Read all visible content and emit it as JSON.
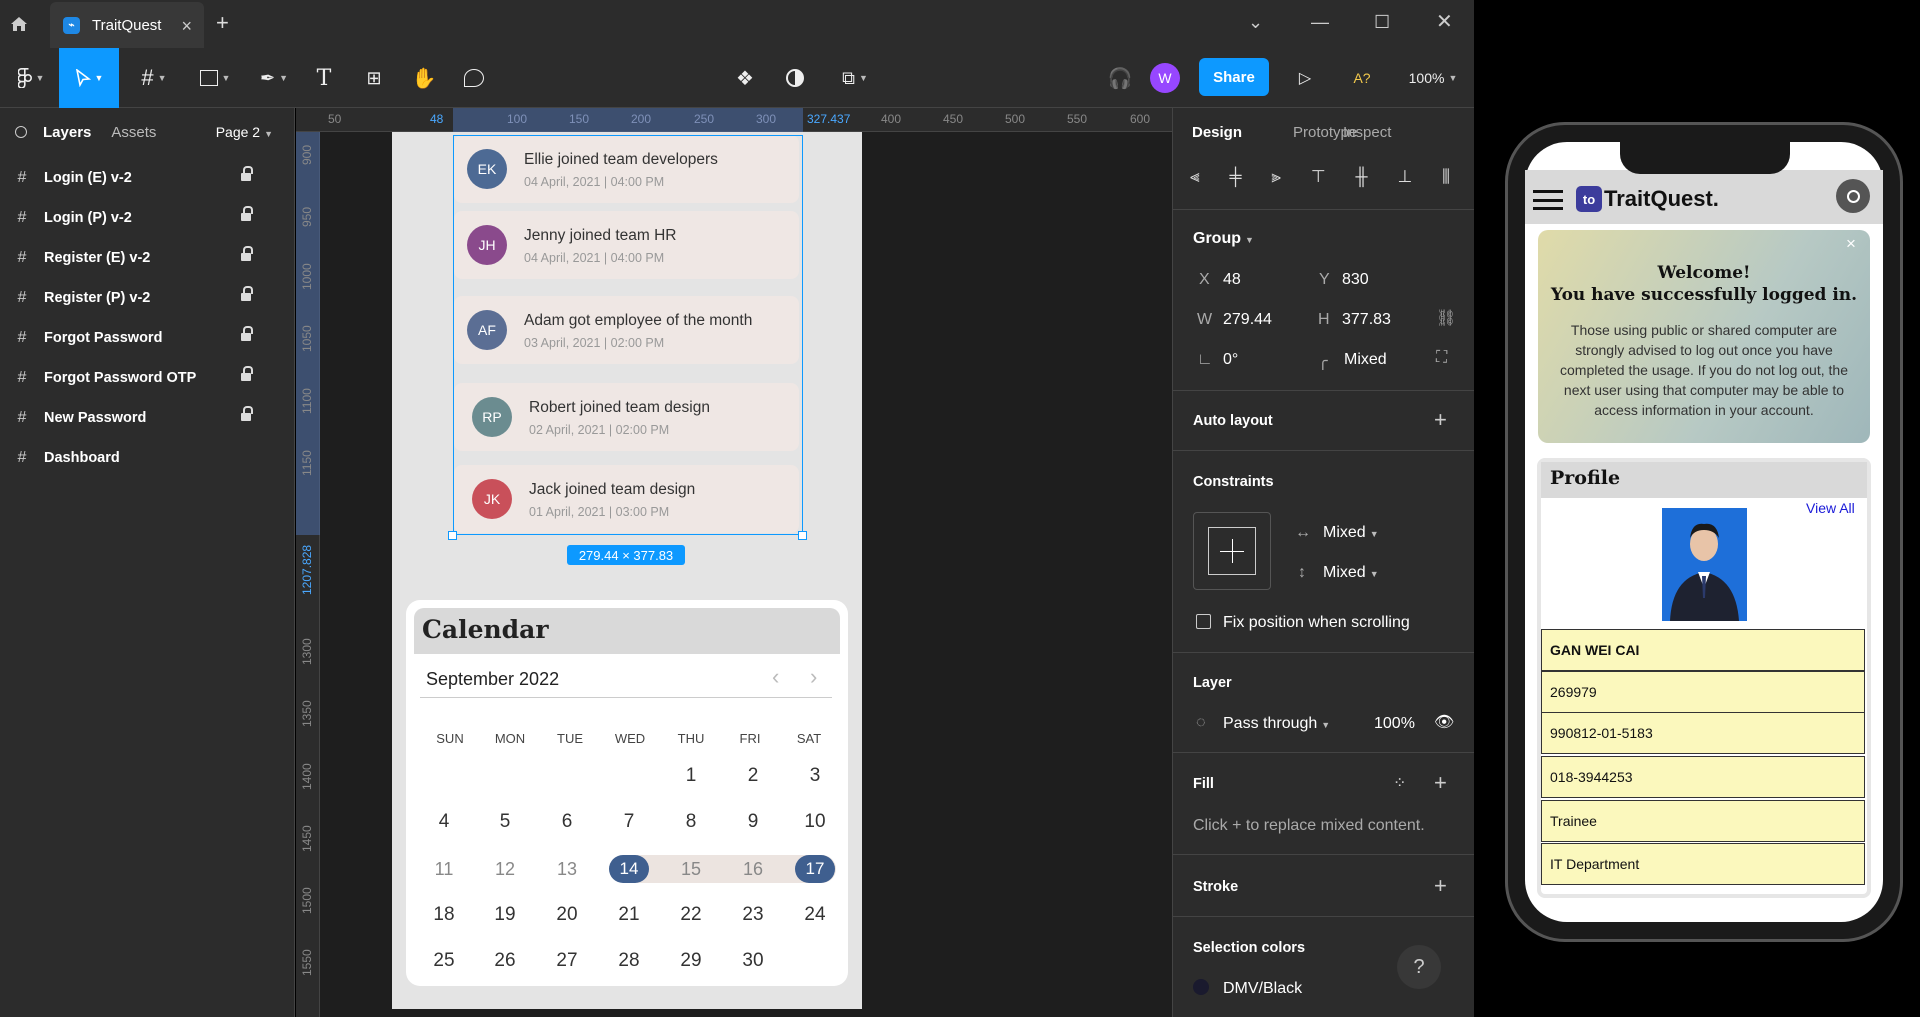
{
  "app": {
    "tab_title": "TraitQuest",
    "colors": {
      "accent": "#0d99ff",
      "panel": "#2c2c2c",
      "canvas": "#1e1e1e",
      "avatar": "#9747ff"
    }
  },
  "toolbar": {
    "share_label": "Share",
    "avatar_initial": "W",
    "font_warning": "A?",
    "zoom": "100%"
  },
  "left_panel": {
    "tabs": {
      "layers": "Layers",
      "assets": "Assets",
      "page": "Page 2"
    },
    "layers": [
      {
        "name": "Login (E) v-2",
        "locked": true
      },
      {
        "name": "Login (P) v-2",
        "locked": true
      },
      {
        "name": "Register (E) v-2",
        "locked": true
      },
      {
        "name": "Register (P) v-2",
        "locked": true
      },
      {
        "name": "Forgot Password",
        "locked": true
      },
      {
        "name": "Forgot Password OTP",
        "locked": true
      },
      {
        "name": "New Password",
        "locked": true
      },
      {
        "name": "Dashboard",
        "locked": false
      }
    ]
  },
  "rulers": {
    "h_ticks": [
      "50",
      "100",
      "150",
      "200",
      "250",
      "300",
      "400",
      "450",
      "500",
      "550",
      "600"
    ],
    "h_sel_start": "48",
    "h_sel_end": "327.437",
    "v_ticks": [
      "900",
      "950",
      "1000",
      "1050",
      "1100",
      "1150",
      "1300",
      "1350",
      "1400",
      "1450",
      "1500",
      "1550"
    ],
    "v_sel_end": "1207.828"
  },
  "canvas": {
    "notifications": [
      {
        "initials": "EK",
        "title": "Ellie joined team developers",
        "date": "04 April, 2021 | 04:00 PM",
        "color": "#4d6a94"
      },
      {
        "initials": "JH",
        "title": "Jenny joined team HR",
        "date": "04 April, 2021 | 04:00 PM",
        "color": "#8a4a8c"
      },
      {
        "initials": "AF",
        "title": "Adam got employee of the month",
        "date": "03 April, 2021 | 02:00 PM",
        "color": "#5b6e94"
      },
      {
        "initials": "RP",
        "title": "Robert joined team design",
        "date": "02 April, 2021 | 02:00 PM",
        "color": "#6b8c90"
      },
      {
        "initials": "JK",
        "title": "Jack joined team design",
        "date": "01 April, 2021 | 03:00 PM",
        "color": "#c9505a"
      }
    ],
    "size_badge": "279.44 × 377.83",
    "calendar": {
      "title": "Calendar",
      "month": "September 2022",
      "prev": "‹",
      "next": "›",
      "weekdays": [
        "SUN",
        "MON",
        "TUE",
        "WED",
        "THU",
        "FRI",
        "SAT"
      ],
      "weeks": [
        [
          "",
          "",
          "",
          "",
          "1",
          "2",
          "3"
        ],
        [
          "4",
          "5",
          "6",
          "7",
          "8",
          "9",
          "10"
        ],
        [
          "11",
          "12",
          "13",
          "14",
          "15",
          "16",
          "17"
        ],
        [
          "18",
          "19",
          "20",
          "21",
          "22",
          "23",
          "24"
        ],
        [
          "25",
          "26",
          "27",
          "28",
          "29",
          "30",
          ""
        ]
      ],
      "range_start": "14",
      "range_end": "17"
    }
  },
  "right_panel": {
    "tabs": {
      "design": "Design",
      "prototype": "Prototype",
      "inspect": "Inspect"
    },
    "group_label": "Group",
    "props": {
      "x_label": "X",
      "x": "48",
      "y_label": "Y",
      "y": "830",
      "w_label": "W",
      "w": "279.44",
      "h_label": "H",
      "h": "377.83",
      "rotation": "0°",
      "radius": "Mixed"
    },
    "auto_layout": "Auto layout",
    "constraints": {
      "title": "Constraints",
      "horizontal": "Mixed",
      "vertical": "Mixed"
    },
    "fix_position": "Fix position when scrolling",
    "layer": {
      "title": "Layer",
      "blend": "Pass through",
      "opacity": "100%"
    },
    "fill": {
      "title": "Fill",
      "hint": "Click + to replace mixed content."
    },
    "stroke": "Stroke",
    "selection_colors": {
      "title": "Selection colors",
      "item": "DMV/Black"
    },
    "help": "?"
  },
  "phone": {
    "brand": "TraitQuest.",
    "brand_logo": "to",
    "welcome_title": "Welcome!",
    "welcome_subtitle": "You have successfully logged in.",
    "welcome_body": "Those using public or shared computer are strongly advised to log out once you have completed the usage. If you do not log out, the next user using that computer may be able to access information in your account.",
    "close": "×",
    "profile_title": "Profile",
    "view_all": "View All",
    "profile_rows": [
      "GAN WEI CAI",
      "269979",
      "990812-01-5183",
      "018-3944253",
      "Trainee",
      "IT Department"
    ]
  }
}
